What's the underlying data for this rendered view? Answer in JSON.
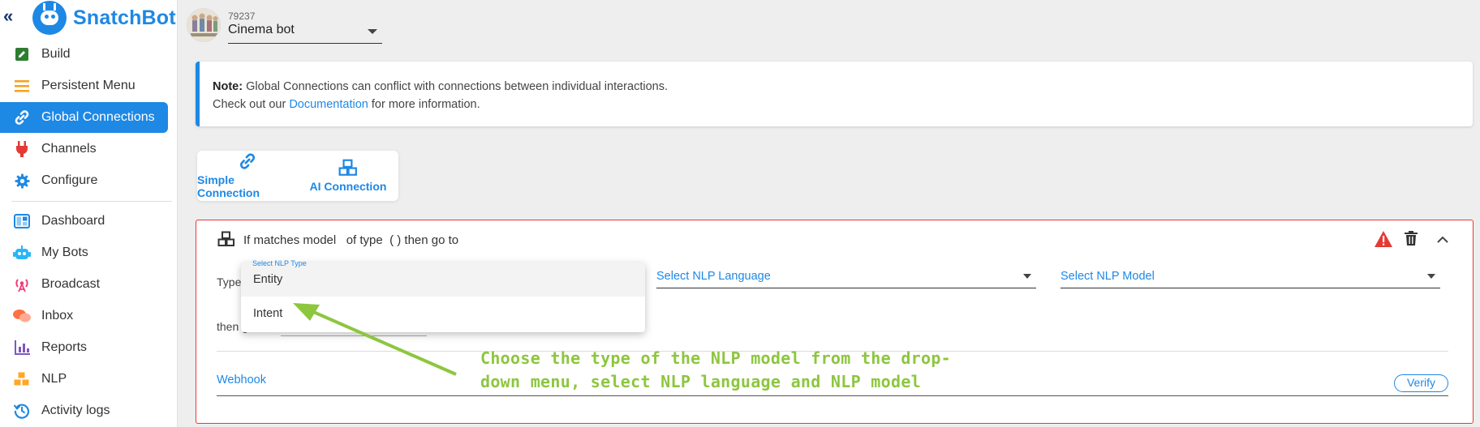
{
  "app": {
    "brand": "SnatchBot",
    "accent": "#1e88e5",
    "alert": "#e53935"
  },
  "sidebar": {
    "collapse_icon": "double-chevron-left-icon",
    "items": [
      {
        "label": "Build",
        "icon": "edit-icon",
        "color": "#2e7d32"
      },
      {
        "label": "Persistent Menu",
        "icon": "menu-icon",
        "color": "#f7a21b"
      },
      {
        "label": "Global Connections",
        "icon": "link-icon",
        "color": "#ffffff",
        "active": true
      },
      {
        "label": "Channels",
        "icon": "plug-icon",
        "color": "#e53935"
      },
      {
        "label": "Configure",
        "icon": "gear-icon",
        "color": "#1e88e5"
      },
      {
        "label": "Dashboard",
        "icon": "dashboard-icon",
        "color": "#1e88e5"
      },
      {
        "label": "My Bots",
        "icon": "robot-icon",
        "color": "#29b6f6"
      },
      {
        "label": "Broadcast",
        "icon": "broadcast-icon",
        "color": "#ec407a"
      },
      {
        "label": "Inbox",
        "icon": "chat-icon",
        "color": "#ff7043"
      },
      {
        "label": "Reports",
        "icon": "bar-chart-icon",
        "color": "#7e57c2"
      },
      {
        "label": "NLP",
        "icon": "cubes-icon",
        "color": "#ffa726"
      },
      {
        "label": "Activity logs",
        "icon": "history-icon",
        "color": "#1e88e5"
      }
    ]
  },
  "header": {
    "bot_id": "79237",
    "bot_name": "Cinema bot"
  },
  "note": {
    "bold": "Note:",
    "line1": " Global Connections can conflict with connections between individual interactions.",
    "line2_pre": "Check out our ",
    "link": "Documentation",
    "line2_post": " for more information."
  },
  "connection_tabs": [
    {
      "label": "Simple Connection",
      "icon": "link-icon"
    },
    {
      "label": "AI Connection",
      "icon": "cubes-icon"
    }
  ],
  "rule": {
    "title": "If matches model   of type  ( ) then go to",
    "type_label": "Type",
    "then_label": "then go to",
    "nlp_language_placeholder": "Select NLP Language",
    "nlp_model_placeholder": "Select NLP Model",
    "webhook_label": "Webhook",
    "verify_label": "Verify"
  },
  "dropdown": {
    "hint": "Select NLP Type",
    "options": [
      "Entity",
      "Intent"
    ]
  },
  "annotation": {
    "line1": "Choose the type of the NLP model from the drop-",
    "line2": "down menu, select NLP language and NLP model",
    "color": "#8dc63f"
  }
}
